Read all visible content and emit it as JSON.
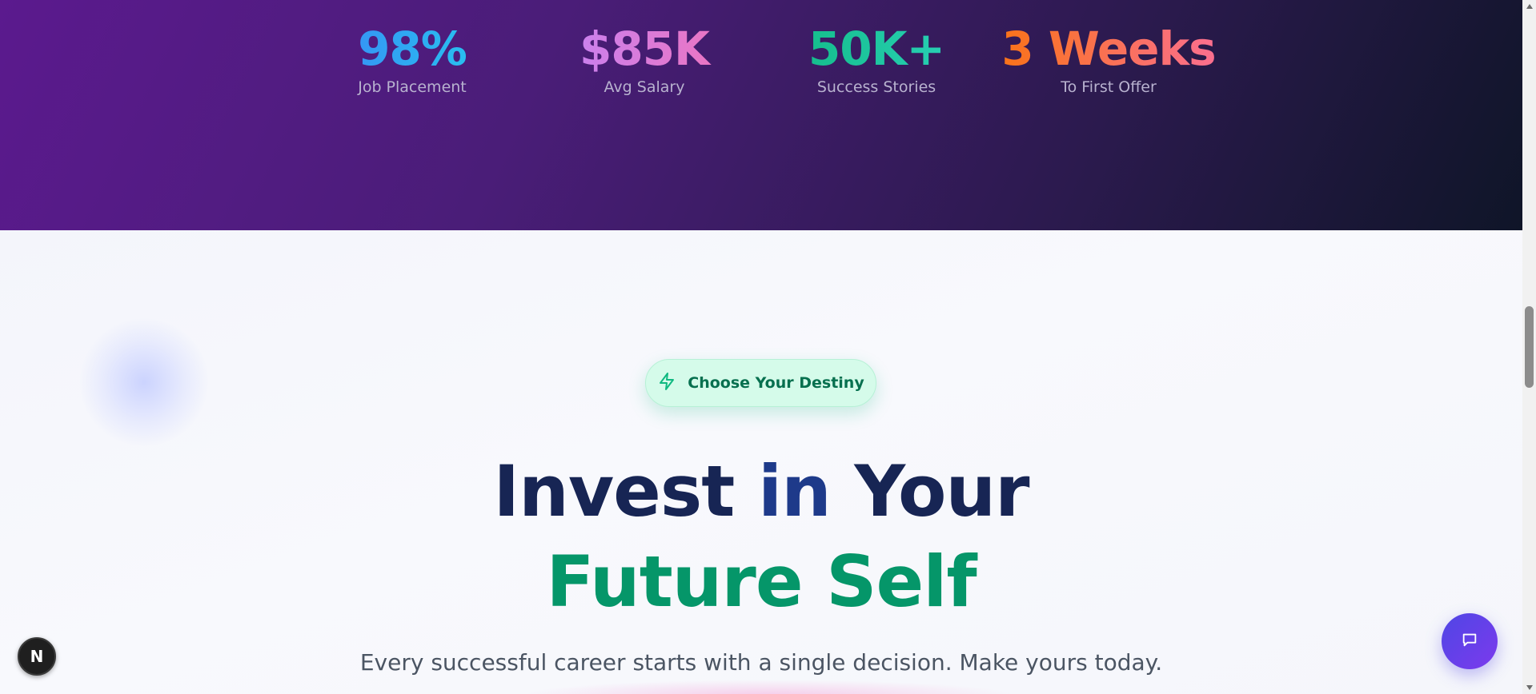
{
  "stats": [
    {
      "value": "98%",
      "label": "Job Placement"
    },
    {
      "value": "$85K",
      "label": "Avg Salary"
    },
    {
      "value": "50K+",
      "label": "Success Stories"
    },
    {
      "value": "3 Weeks",
      "label": "To First Offer"
    }
  ],
  "hero": {
    "badge_label": "Choose Your Destiny",
    "badge_icon": "lightning-icon",
    "headline_line1_a": "Invest ",
    "headline_line1_b": "in",
    "headline_line1_c": " Your",
    "headline_line2": "Future Self",
    "subtitle": "Every successful career starts with a single decision. Make yours today."
  },
  "floating": {
    "n_badge_label": "N",
    "chat_icon": "chat-icon"
  },
  "colors": {
    "band_start": "#5b1a8e",
    "band_end": "#0f1528",
    "headline_navy": "#172554",
    "headline_green": "#059669",
    "badge_bg": "#d5fbea",
    "chat_button": "#4f46e5"
  }
}
